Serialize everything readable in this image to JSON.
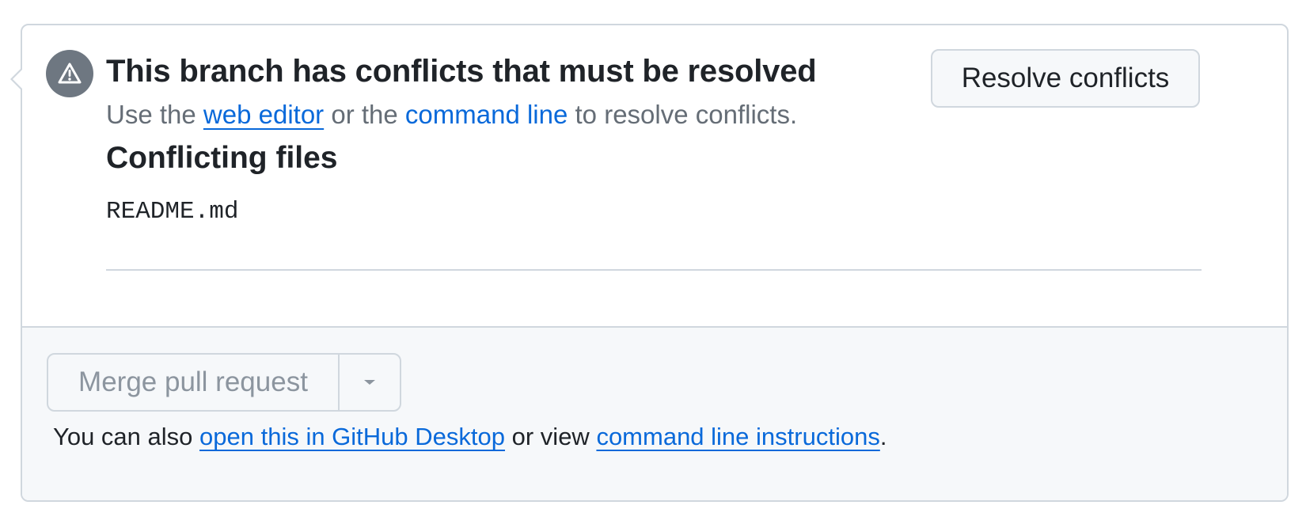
{
  "alert": {
    "icon": "alert-triangle-icon",
    "title": "This branch has conflicts that must be resolved",
    "subtitle_prefix": "Use the ",
    "web_editor_link": "web editor",
    "subtitle_middle": " or the ",
    "command_line_link": "command line",
    "subtitle_suffix": " to resolve conflicts.",
    "resolve_button": "Resolve conflicts"
  },
  "conflicting_files": {
    "heading": "Conflicting files",
    "files": [
      "README.md"
    ]
  },
  "merge": {
    "button_label": "Merge pull request",
    "dropdown_icon": "caret-down-icon",
    "note_prefix": "You can also ",
    "desktop_link": "open this in GitHub Desktop",
    "note_middle": " or view ",
    "instructions_link": "command line instructions",
    "note_suffix": "."
  },
  "colors": {
    "link": "#0969da",
    "border": "#d0d7de",
    "muted_text": "#656d76",
    "disabled_text": "#8c959f",
    "footer_bg": "#f6f8fa",
    "icon_bg": "#6e7781"
  }
}
